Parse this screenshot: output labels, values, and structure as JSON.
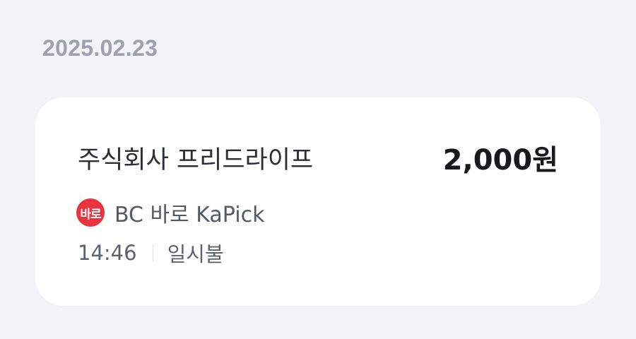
{
  "date_header": "2025.02.23",
  "transaction": {
    "merchant": "주식회사 프리드라이프",
    "amount": "2,000원",
    "card_logo_text": "바로",
    "card_name": "BC 바로 KaPick",
    "time": "14:46",
    "payment_type": "일시불"
  },
  "colors": {
    "background": "#f2f3f6",
    "card": "#ffffff",
    "card_logo": "#e8343f",
    "date_text": "#9ba1ad"
  }
}
